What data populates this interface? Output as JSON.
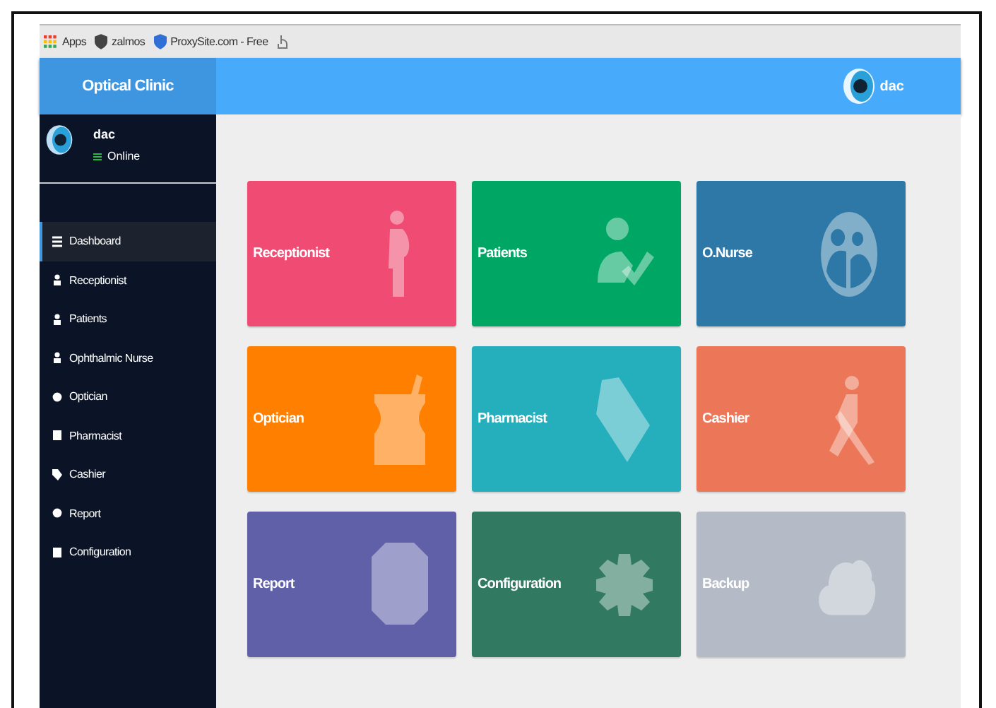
{
  "bookmarks": [
    {
      "label": "Apps"
    },
    {
      "label": "zalmos"
    },
    {
      "label": "ProxySite.com - Free"
    }
  ],
  "header": {
    "brand": "Optical Clinic",
    "user": "dac"
  },
  "sidebar": {
    "user": "dac",
    "status": "Online",
    "items": [
      {
        "label": "Dashboard",
        "selected": true
      },
      {
        "label": "Receptionist",
        "selected": false
      },
      {
        "label": "Patients",
        "selected": false
      },
      {
        "label": "Ophthalmic Nurse",
        "selected": false
      },
      {
        "label": "Optician",
        "selected": false
      },
      {
        "label": "Pharmacist",
        "selected": false
      },
      {
        "label": "Cashier",
        "selected": false
      },
      {
        "label": "Report",
        "selected": false
      },
      {
        "label": "Configuration",
        "selected": false
      }
    ]
  },
  "tiles": [
    {
      "label": "Receptionist",
      "color": "#ef4b73"
    },
    {
      "label": "Patients",
      "color": "#00a764"
    },
    {
      "label": "O.Nurse",
      "color": "#2d78a6"
    },
    {
      "label": "Optician",
      "color": "#ff7f00"
    },
    {
      "label": "Pharmacist",
      "color": "#25aebb"
    },
    {
      "label": "Cashier",
      "color": "#ec7758"
    },
    {
      "label": "Report",
      "color": "#5f60a8"
    },
    {
      "label": "Configuration",
      "color": "#317a61"
    },
    {
      "label": "Backup",
      "color": "#b4bbc7"
    }
  ]
}
